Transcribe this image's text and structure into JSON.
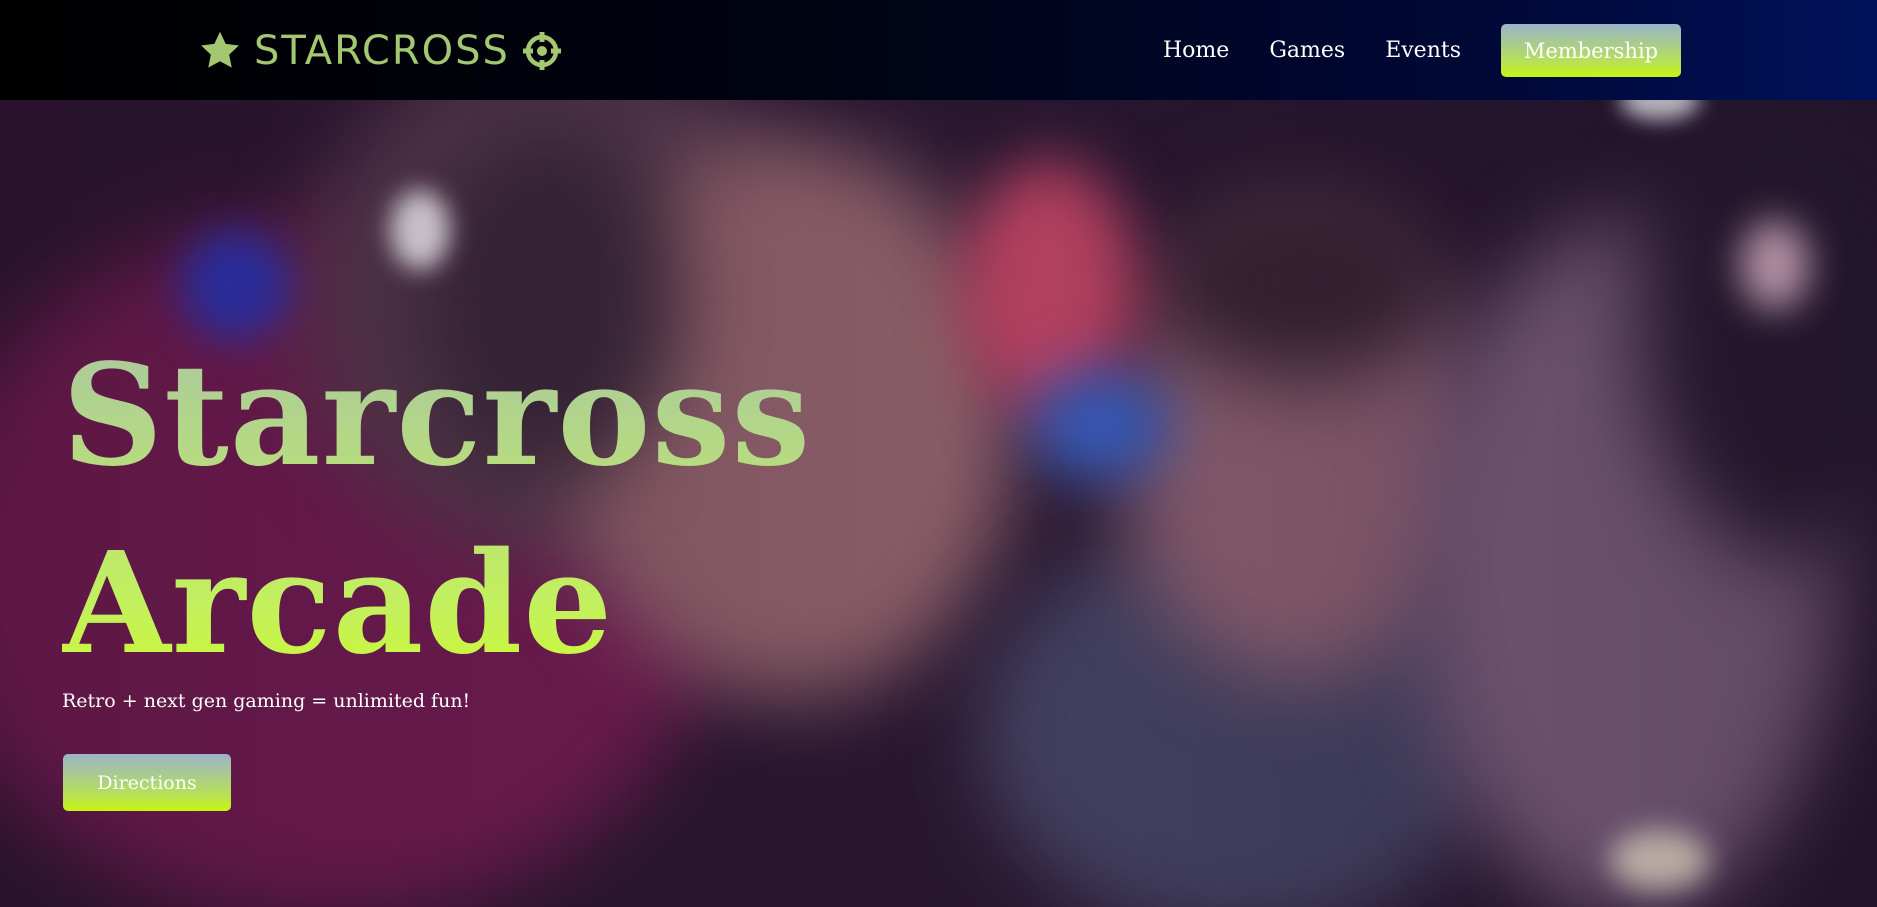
{
  "brand": {
    "name": "STARCROSS",
    "left_icon": "star-icon",
    "right_icon": "crosshair-icon",
    "color": "#a4c871"
  },
  "nav": {
    "links": [
      {
        "label": "Home"
      },
      {
        "label": "Games"
      },
      {
        "label": "Events"
      }
    ],
    "cta_label": "Membership"
  },
  "hero": {
    "title_line1": "Starcross",
    "title_line2": "Arcade",
    "tagline": "Retro + next gen gaming = unlimited fun!",
    "cta_label": "Directions",
    "image": "arcade-patrons-photo"
  },
  "colors": {
    "accent_green": "#c8f510",
    "accent_blue_gray": "#9ab4c8",
    "nav_bg_start": "#000000",
    "nav_bg_end": "#00125a"
  }
}
